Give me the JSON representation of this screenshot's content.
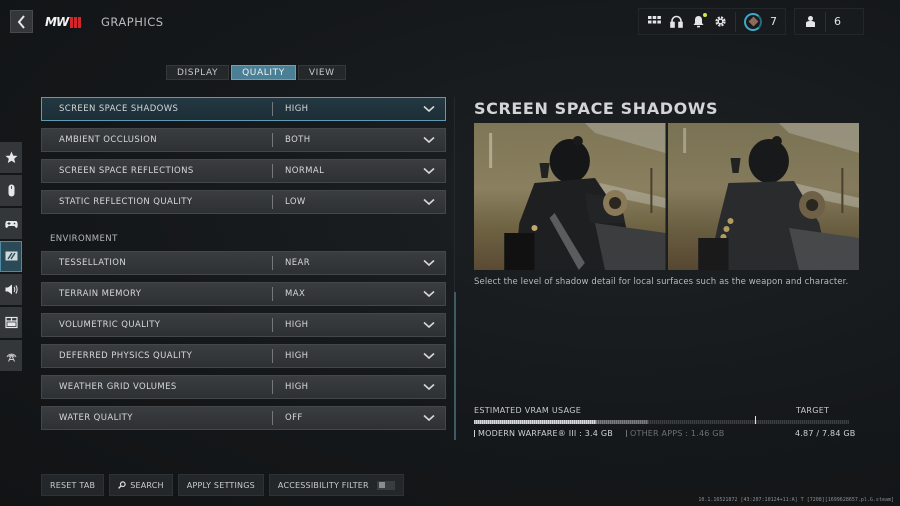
{
  "header": {
    "back_label": "Back",
    "logo_text": "MW",
    "title": "GRAPHICS",
    "icons": [
      "grid-icon",
      "headset-icon",
      "bell-icon",
      "gear-icon"
    ],
    "notification_dot_color": "#d6e34a",
    "player_level": "7",
    "party_icon": "operator-icon",
    "party_count": "6"
  },
  "tabs": [
    {
      "label": "DISPLAY",
      "active": false
    },
    {
      "label": "QUALITY",
      "active": true
    },
    {
      "label": "VIEW",
      "active": false
    }
  ],
  "rail": [
    {
      "name": "favorites",
      "icon": "star-icon",
      "active": false
    },
    {
      "name": "mouse",
      "icon": "mouse-icon",
      "active": false
    },
    {
      "name": "controller",
      "icon": "gamepad-icon",
      "active": false
    },
    {
      "name": "graphics",
      "icon": "monitor-icon",
      "active": true
    },
    {
      "name": "audio",
      "icon": "speaker-icon",
      "active": false
    },
    {
      "name": "interface",
      "icon": "interface-icon",
      "active": false
    },
    {
      "name": "network",
      "icon": "signal-tower-icon",
      "active": false
    }
  ],
  "settings": {
    "group1": [
      {
        "label": "SCREEN SPACE SHADOWS",
        "value": "HIGH",
        "selected": true
      },
      {
        "label": "AMBIENT OCCLUSION",
        "value": "BOTH"
      },
      {
        "label": "SCREEN SPACE REFLECTIONS",
        "value": "NORMAL"
      },
      {
        "label": "STATIC REFLECTION QUALITY",
        "value": "LOW"
      }
    ],
    "environment_label": "ENVIRONMENT",
    "environment": [
      {
        "label": "TESSELLATION",
        "value": "NEAR"
      },
      {
        "label": "TERRAIN MEMORY",
        "value": "MAX"
      },
      {
        "label": "VOLUMETRIC QUALITY",
        "value": "HIGH"
      },
      {
        "label": "DEFERRED PHYSICS QUALITY",
        "value": "HIGH"
      },
      {
        "label": "WEATHER GRID VOLUMES",
        "value": "HIGH"
      },
      {
        "label": "WATER QUALITY",
        "value": "OFF"
      }
    ]
  },
  "detail": {
    "title": "SCREEN SPACE SHADOWS",
    "description": "Select the level of shadow detail for local surfaces such as the weapon and character."
  },
  "vram": {
    "title": "ESTIMATED VRAM USAGE",
    "target_label": "TARGET",
    "mw_label": "MODERN WARFARE® III : 3.4 GB",
    "other_label": "OTHER APPS : 1.46 GB",
    "total_label": "4.87 / 7.84 GB",
    "mw_gb": 3.4,
    "other_gb": 1.46,
    "target_gb": 7.84,
    "total_gb": 7.84,
    "target_fraction": 0.75
  },
  "bottom": {
    "reset_tab": "RESET TAB",
    "search": "SEARCH",
    "apply_settings": "APPLY SETTINGS",
    "accessibility_filter": "ACCESSIBILITY FILTER",
    "accessibility_filter_on": false
  },
  "version": "10.1.16521872 [43:207:10124+11:A] T [7208][1699628657.pl.G.steam]"
}
